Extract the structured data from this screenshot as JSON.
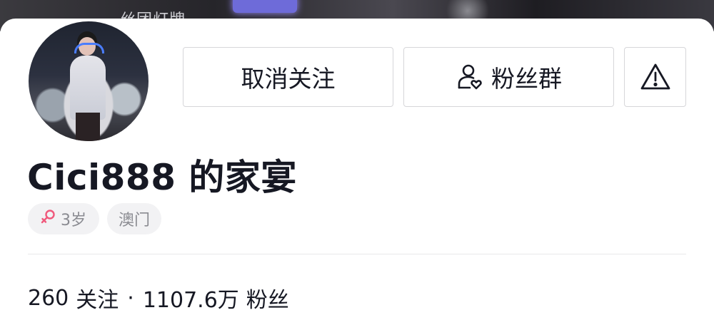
{
  "banner": {
    "partial_text": "丝团灯牌"
  },
  "profile": {
    "nickname": "Cici888 的家宴",
    "age_tag": "3岁",
    "region_tag": "澳门"
  },
  "actions": {
    "unfollow_label": "取消关注",
    "fans_group_label": "粉丝群",
    "report_icon": "warning-triangle-icon"
  },
  "stats": {
    "following_count": "260",
    "following_label": "关注",
    "separator": "·",
    "followers_count": "1107.6万",
    "followers_label": "粉丝"
  },
  "colors": {
    "text": "#161823",
    "muted": "#8a8b91",
    "female_icon": "#f0597c",
    "border": "#d6d6d9"
  }
}
